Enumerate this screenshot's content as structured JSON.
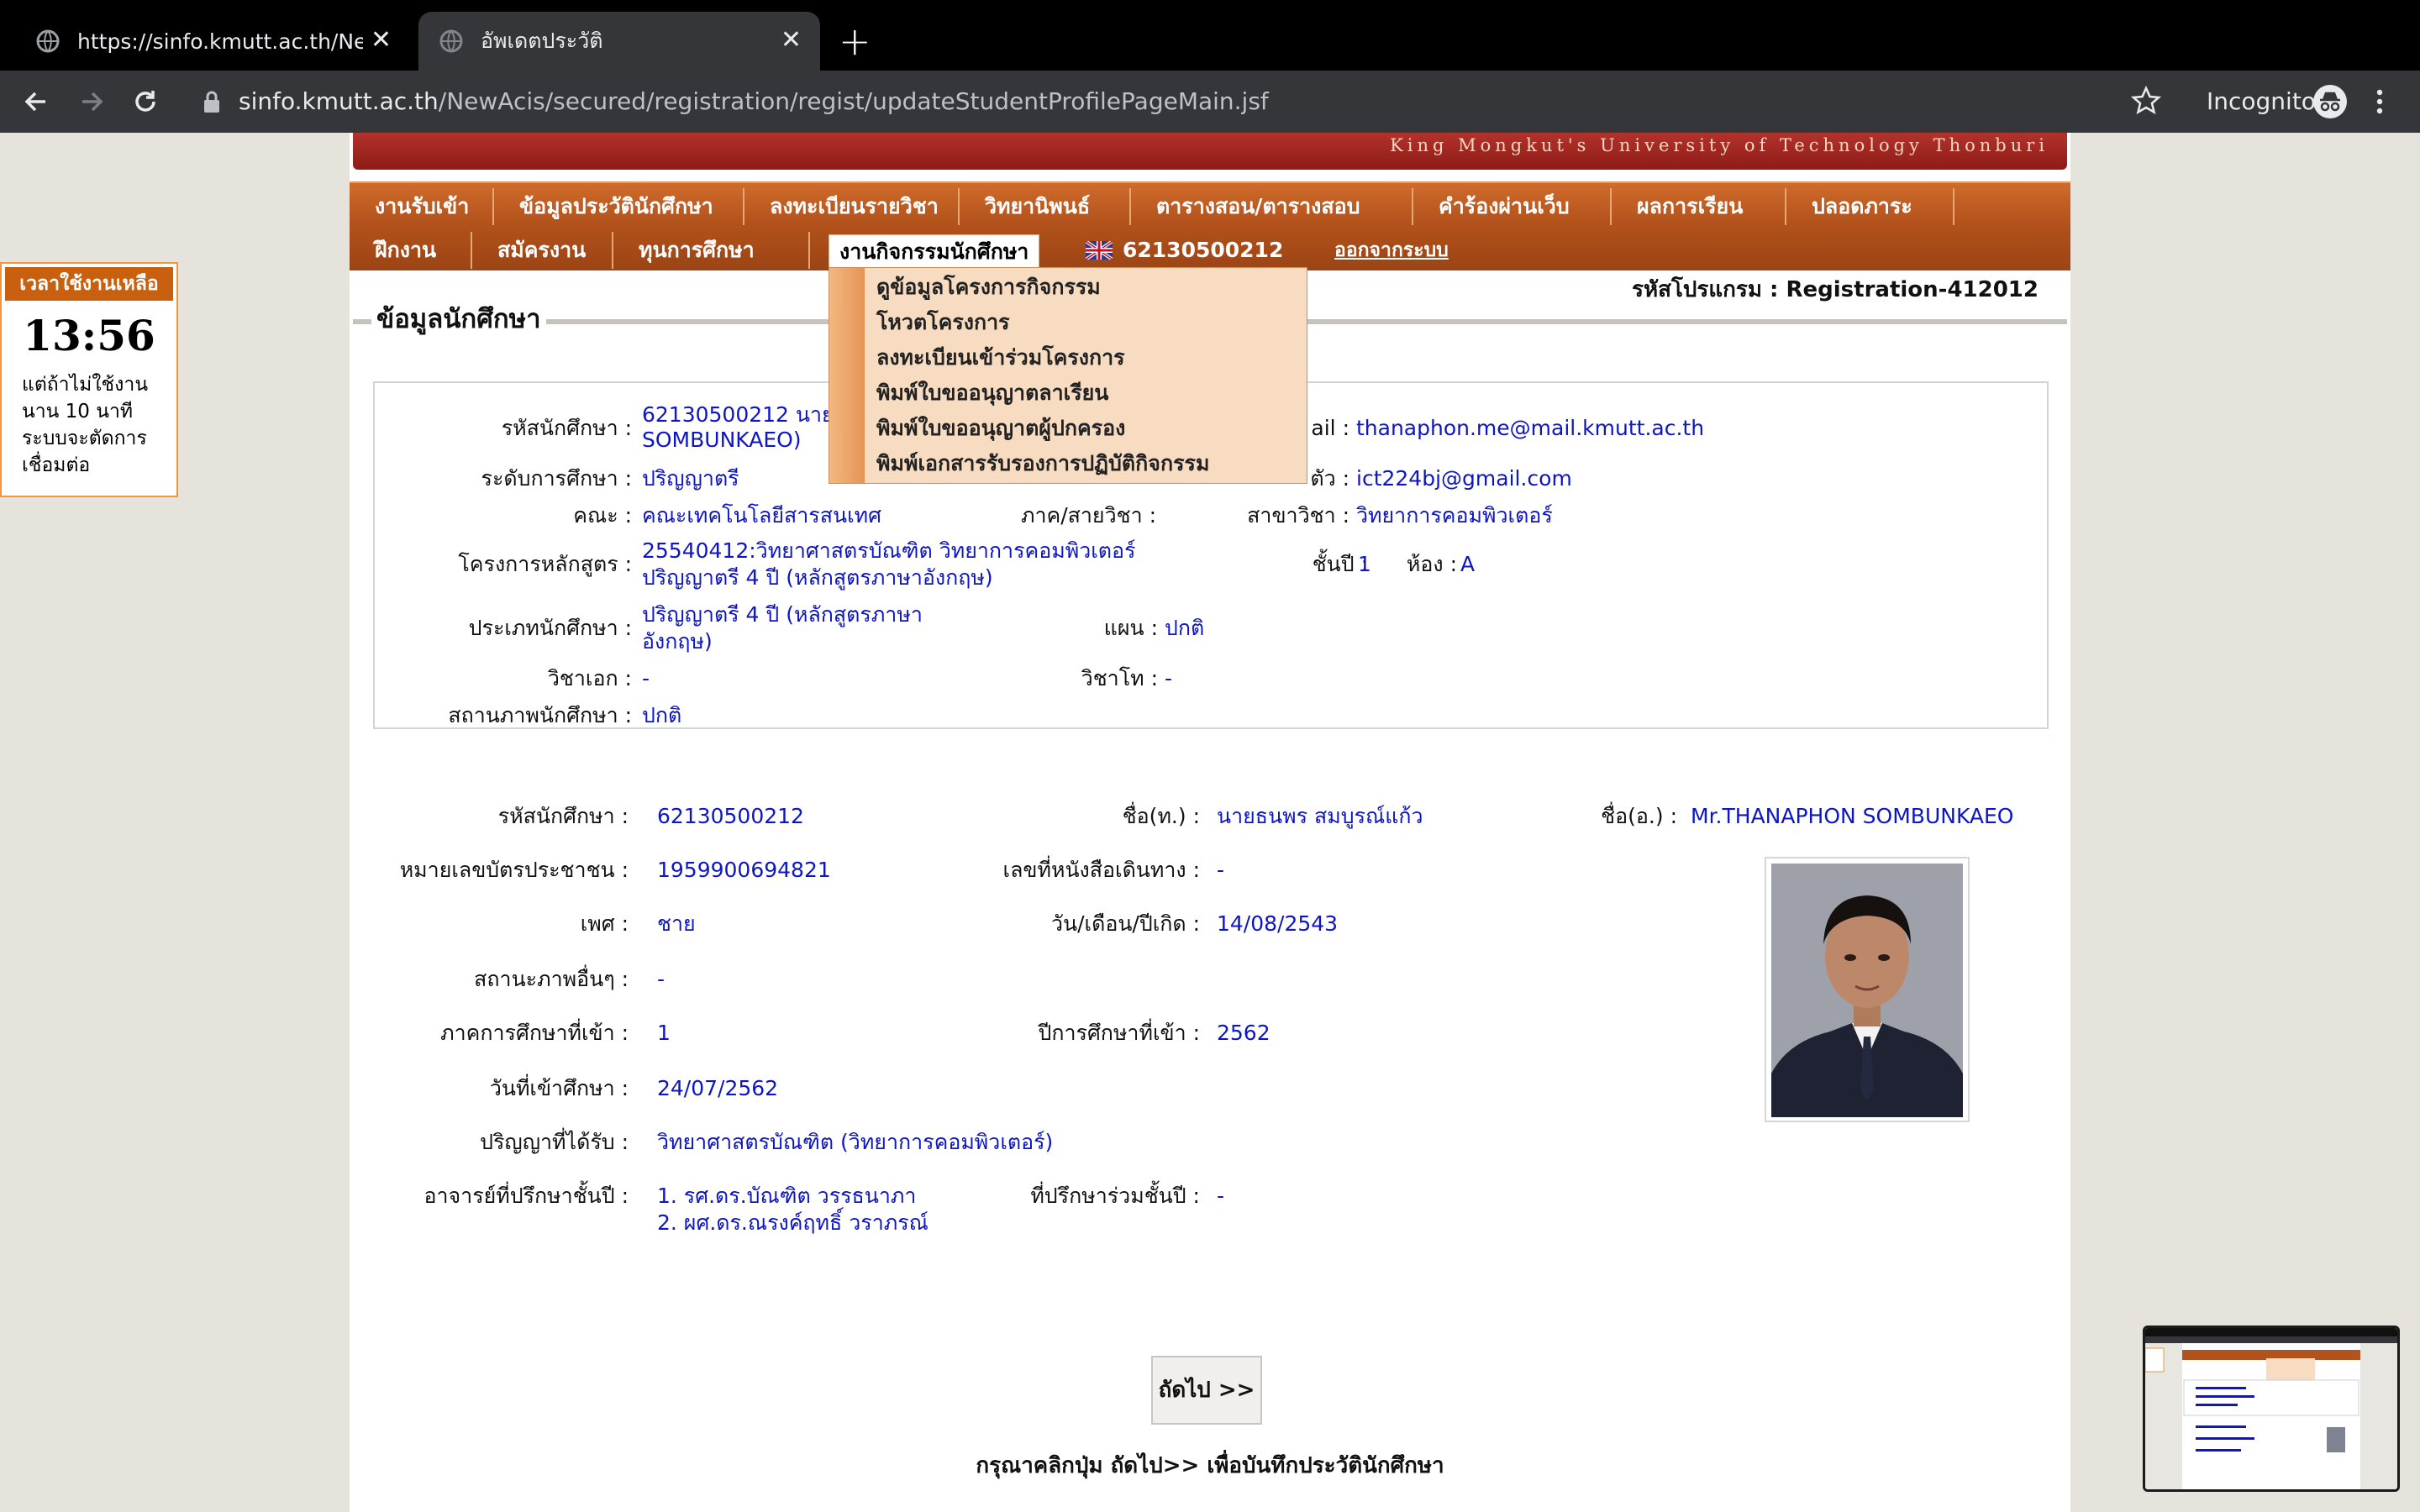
{
  "browser": {
    "tabs": [
      {
        "title": "https://sinfo.kmutt.ac.th/NewAcis",
        "active": false
      },
      {
        "title": "อัพเดตประวัติ",
        "active": true
      }
    ],
    "url_host": "sinfo.kmutt.ac.th",
    "url_path": "/NewAcis/secured/registration/regist/updateStudentProfilePageMain.jsf",
    "incognito_label": "Incognito"
  },
  "banner": {
    "text": "King Mongkut's University of Technology Thonburi"
  },
  "menu": {
    "row1": [
      "งานรับเข้า",
      "ข้อมูลประวัตินักศึกษา",
      "ลงทะเบียนรายวิชา",
      "วิทยานิพนธ์",
      "ตารางสอน/ตารางสอบ",
      "คำร้องผ่านเว็บ",
      "ผลการเรียน",
      "ปลอดภาระ"
    ],
    "row2": [
      "ฝึกงาน",
      "สมัครงาน",
      "ทุนการศึกษา"
    ],
    "active": "งานกิจกรรมนักศึกษา",
    "student_id": "62130500212",
    "logout": "ออกจากระบบ"
  },
  "dropdown": {
    "items": [
      "ดูข้อมูลโครงการกิจกรรม",
      "โหวตโครงการ",
      "ลงทะเบียนเข้าร่วมโครงการ",
      "พิมพ์ใบขออนุญาตลาเรียน",
      "พิมพ์ใบขออนุญาตผู้ปกครอง",
      "พิมพ์เอกสารรับรองการปฏิบัติกิจกรรม"
    ]
  },
  "program_code": "รหัสโปรแกรม : Registration-412012",
  "section_title": "ข้อมูลนักศึกษา",
  "summary": {
    "student_id_label": "รหัสนักศึกษา :",
    "student_id_value_1": "62130500212 นายธ",
    "student_id_value_2": "SOMBUNKAEO)",
    "email_label": "ail :",
    "email_value": "thanaphon.me@mail.kmutt.ac.th",
    "level_label": "ระดับการศึกษา :",
    "level_value": "ปริญญาตรี",
    "personal_email_label": "ตัว :",
    "personal_email_value": "ict224bj@gmail.com",
    "faculty_label": "คณะ :",
    "faculty_value": "คณะเทคโนโลยีสารสนเทศ",
    "dept_label": "ภาค/สายวิชา :",
    "major_label": "สาขาวิชา :",
    "major_value": "วิทยาการคอมพิวเตอร์",
    "curriculum_label": "โครงการหลักสูตร :",
    "curriculum_value_1": "25540412:วิทยาศาสตรบัณฑิต วิทยาการคอมพิวเตอร์",
    "curriculum_value_2": "ปริญญาตรี 4 ปี (หลักสูตรภาษาอังกฤษ)",
    "year_label": "ชั้นปี :",
    "year_value": "1",
    "room_label": "ห้อง :",
    "room_value": "A",
    "type_label": "ประเภทนักศึกษา :",
    "type_value_1": "ปริญญาตรี 4 ปี (หลักสูตรภาษา",
    "type_value_2": "อังกฤษ)",
    "plan_label": "แผน :",
    "plan_value": "ปกติ",
    "minor1_label": "วิชาเอก :",
    "minor1_value": "-",
    "minor2_label": "วิชาโท :",
    "minor2_value": "-",
    "status_label": "สถานภาพนักศึกษา :",
    "status_value": "ปกติ"
  },
  "details": {
    "sid_label": "รหัสนักศึกษา :",
    "sid_value": "62130500212",
    "name_th_label": "ชื่อ(ท.) :",
    "name_th_value": "นายธนพร สมบูรณ์แก้ว",
    "name_en_label": "ชื่อ(อ.) :",
    "name_en_value": "Mr.THANAPHON SOMBUNKAEO",
    "citizen_label": "หมายเลขบัตรประชาชน :",
    "citizen_value": "1959900694821",
    "passport_label": "เลขที่หนังสือเดินทาง :",
    "passport_value": "-",
    "gender_label": "เพศ :",
    "gender_value": "ชาย",
    "dob_label": "วัน/เดือน/ปีเกิด :",
    "dob_value": "14/08/2543",
    "other_status_label": "สถานะภาพอื่นๆ :",
    "other_status_value": "-",
    "entry_sem_label": "ภาคการศึกษาที่เข้า :",
    "entry_sem_value": "1",
    "entry_year_label": "ปีการศึกษาที่เข้า :",
    "entry_year_value": "2562",
    "entry_date_label": "วันที่เข้าศึกษา :",
    "entry_date_value": "24/07/2562",
    "degree_label": "ปริญญาที่ได้รับ :",
    "degree_value": "วิทยาศาสตรบัณฑิต (วิทยาการคอมพิวเตอร์)",
    "advisor_label": "อาจารย์ที่ปรึกษาชั้นปี :",
    "advisor_1": "1. รศ.ดร.บัณฑิต วรรธนาภา",
    "advisor_2": "2. ผศ.ดร.ณรงค์ฤทธิ์ วราภรณ์",
    "co_advisor_label": "ที่ปรึกษาร่วมชั้นปี :",
    "co_advisor_value": "-"
  },
  "next_button": "ถัดไป >>",
  "hint": "กรุณาคลิกปุ่ม ถัดไป>> เพื่อบันทึกประวัตินักศึกษา",
  "timer": {
    "header": "เวลาใช้งานเหลือ",
    "time": "13:56",
    "note": "แต่ถ้าไม่ใช้งานนาน 10 นาทีระบบจะตัดการเชื่อมต่อ"
  },
  "colors": {
    "menu": "#b3521c",
    "value_text": "#0d16c2",
    "banner": "#a3241f"
  }
}
